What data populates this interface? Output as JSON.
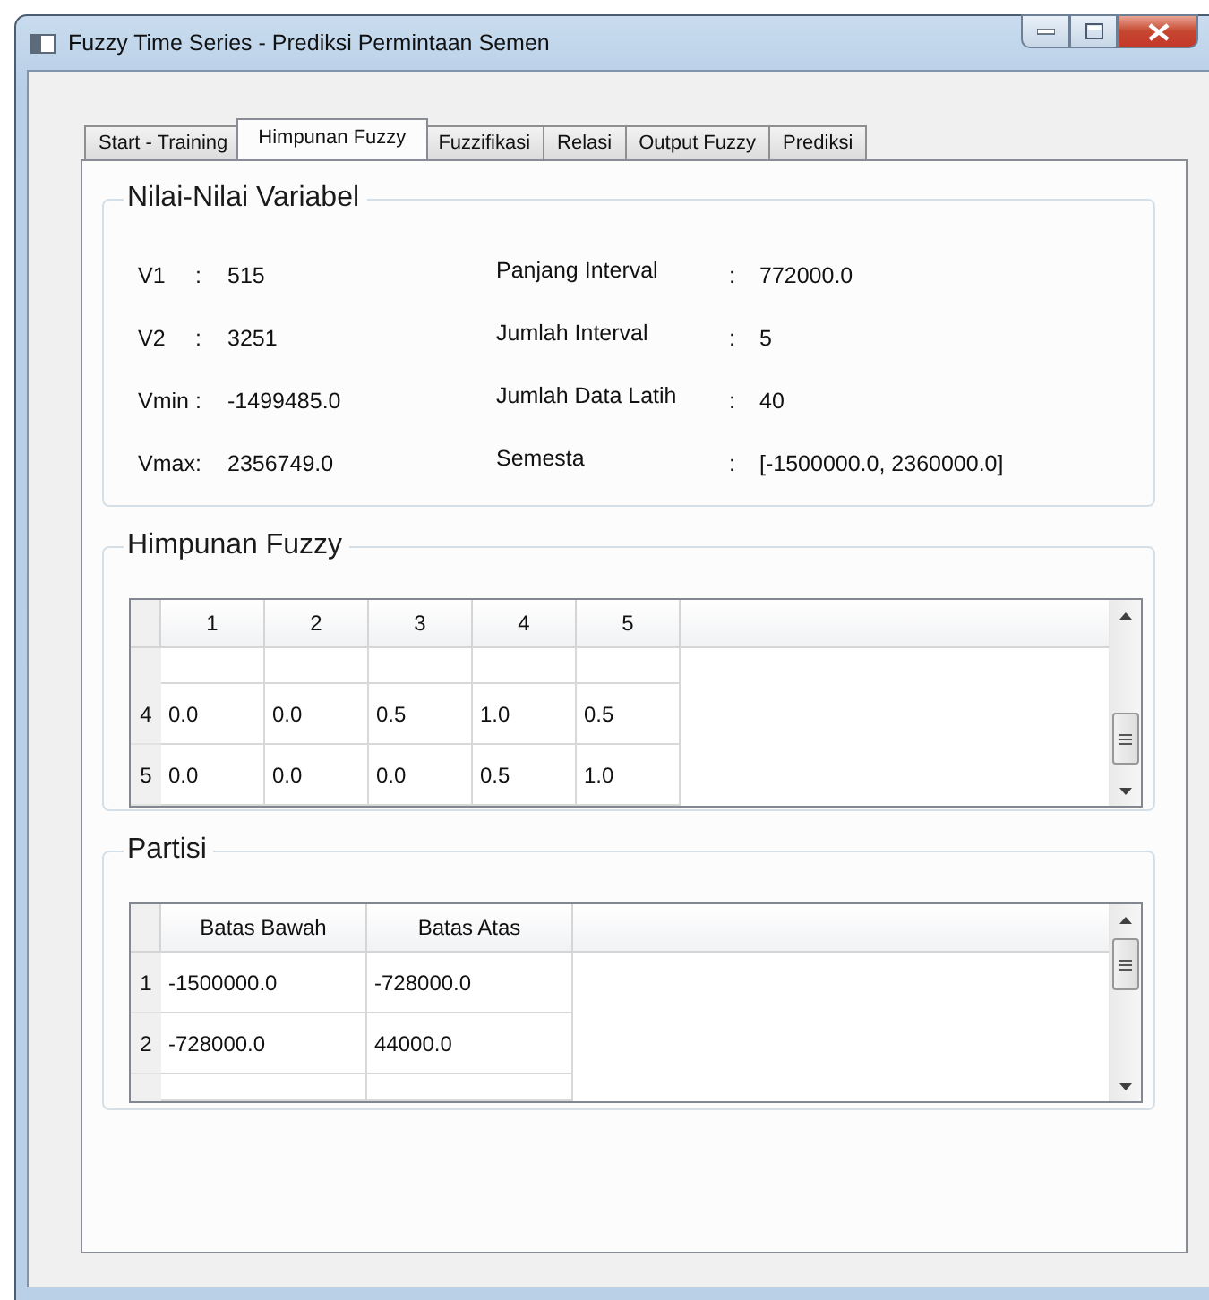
{
  "window": {
    "title": "Fuzzy Time Series - Prediksi Permintaan Semen"
  },
  "tabs": [
    {
      "label": "Start - Training",
      "selected": false
    },
    {
      "label": "Himpunan Fuzzy",
      "selected": true
    },
    {
      "label": "Fuzzifikasi",
      "selected": false
    },
    {
      "label": "Relasi",
      "selected": false
    },
    {
      "label": "Output Fuzzy",
      "selected": false
    },
    {
      "label": "Prediksi",
      "selected": false
    }
  ],
  "variables": {
    "title": "Nilai-Nilai Variabel",
    "left": [
      {
        "label": "V1",
        "separator": ":",
        "value": "515"
      },
      {
        "label": "V2",
        "separator": ":",
        "value": "3251"
      },
      {
        "label": "Vmin",
        "separator": ":",
        "value": "-1499485.0"
      },
      {
        "label": "Vmax",
        "separator": ":",
        "value": "2356749.0"
      }
    ],
    "right": [
      {
        "label": "Panjang Interval",
        "separator": ":",
        "value": "772000.0"
      },
      {
        "label": "Jumlah Interval",
        "separator": ":",
        "value": "5"
      },
      {
        "label": "Jumlah Data Latih",
        "separator": ":",
        "value": "40"
      },
      {
        "label": "Semesta",
        "separator": ":",
        "value": "[-1500000.0, 2360000.0]"
      }
    ]
  },
  "fuzzy_sets": {
    "title": "Himpunan Fuzzy",
    "columns": [
      "1",
      "2",
      "3",
      "4",
      "5"
    ],
    "rows": [
      {
        "header": "4",
        "cells": [
          "0.0",
          "0.0",
          "0.5",
          "1.0",
          "0.5"
        ]
      },
      {
        "header": "5",
        "cells": [
          "0.0",
          "0.0",
          "0.0",
          "0.5",
          "1.0"
        ]
      }
    ]
  },
  "partition": {
    "title": "Partisi",
    "columns": [
      "Batas Bawah",
      "Batas Atas"
    ],
    "rows": [
      {
        "header": "1",
        "cells": [
          "-1500000.0",
          "-728000.0"
        ]
      },
      {
        "header": "2",
        "cells": [
          "-728000.0",
          "44000.0"
        ]
      }
    ]
  }
}
